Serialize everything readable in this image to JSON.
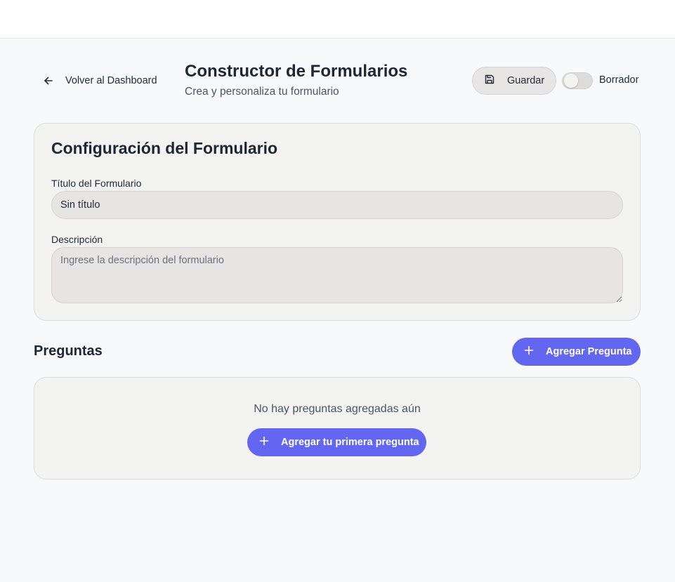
{
  "header": {
    "back_label": "Volver al Dashboard",
    "title": "Constructor de Formularios",
    "subtitle": "Crea y personaliza tu formulario",
    "save_label": "Guardar",
    "status_label": "Borrador",
    "status_toggle_on": false
  },
  "config": {
    "heading": "Configuración del Formulario",
    "title_label": "Título del Formulario",
    "title_value": "Sin título",
    "description_label": "Descripción",
    "description_placeholder": "Ingrese la descripción del formulario"
  },
  "questions": {
    "heading": "Preguntas",
    "add_label": "Agregar Pregunta",
    "empty_text": "No hay preguntas agregadas aún",
    "add_first_label": "Agregar tu primera pregunta"
  },
  "icons": {
    "back": "arrow-left-icon",
    "save": "save-icon",
    "add": "plus-icon"
  },
  "colors": {
    "primary": "#6366f1",
    "page_background": "#f8f9fb",
    "card_background": "#f3f3f1"
  }
}
